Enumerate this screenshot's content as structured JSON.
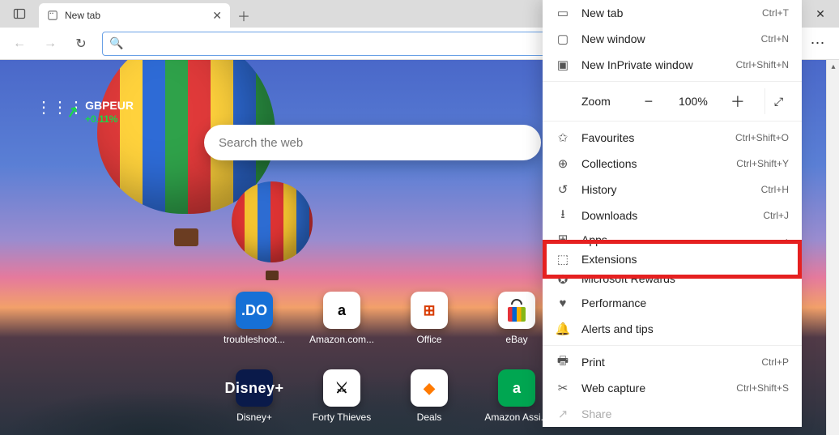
{
  "tab": {
    "title": "New tab"
  },
  "ticker": {
    "symbol": "GBPEUR",
    "change": "+0.11%"
  },
  "search": {
    "placeholder": "Search the web"
  },
  "tiles": [
    {
      "label": "troubleshoot...",
      "iconClass": "i-do",
      "iconText": ".DO"
    },
    {
      "label": "Amazon.com...",
      "iconClass": "i-amz",
      "iconText": "a"
    },
    {
      "label": "Office",
      "iconClass": "i-off",
      "iconText": "⊞"
    },
    {
      "label": "eBay",
      "iconClass": "i-ebay",
      "iconText": ""
    },
    {
      "label": "Disney+",
      "iconClass": "i-dplus",
      "iconText": "Disney+"
    },
    {
      "label": "Forty Thieves",
      "iconClass": "i-forty",
      "iconText": "⚔"
    },
    {
      "label": "Deals",
      "iconClass": "i-deals",
      "iconText": "◆"
    },
    {
      "label": "Amazon Assi...",
      "iconClass": "i-assist",
      "iconText": "a"
    }
  ],
  "zoom": {
    "label": "Zoom",
    "value": "100%"
  },
  "menu": {
    "new_tab": {
      "label": "New tab",
      "shortcut": "Ctrl+T"
    },
    "new_window": {
      "label": "New window",
      "shortcut": "Ctrl+N"
    },
    "new_inprivate": {
      "label": "New InPrivate window",
      "shortcut": "Ctrl+Shift+N"
    },
    "favourites": {
      "label": "Favourites",
      "shortcut": "Ctrl+Shift+O"
    },
    "collections": {
      "label": "Collections",
      "shortcut": "Ctrl+Shift+Y"
    },
    "history": {
      "label": "History",
      "shortcut": "Ctrl+H"
    },
    "downloads": {
      "label": "Downloads",
      "shortcut": "Ctrl+J"
    },
    "apps": {
      "label": "Apps"
    },
    "extensions": {
      "label": "Extensions"
    },
    "rewards": {
      "label": "Microsoft Rewards"
    },
    "performance": {
      "label": "Performance"
    },
    "alerts": {
      "label": "Alerts and tips"
    },
    "print": {
      "label": "Print",
      "shortcut": "Ctrl+P"
    },
    "web_capture": {
      "label": "Web capture",
      "shortcut": "Ctrl+Shift+S"
    },
    "share": {
      "label": "Share"
    }
  }
}
